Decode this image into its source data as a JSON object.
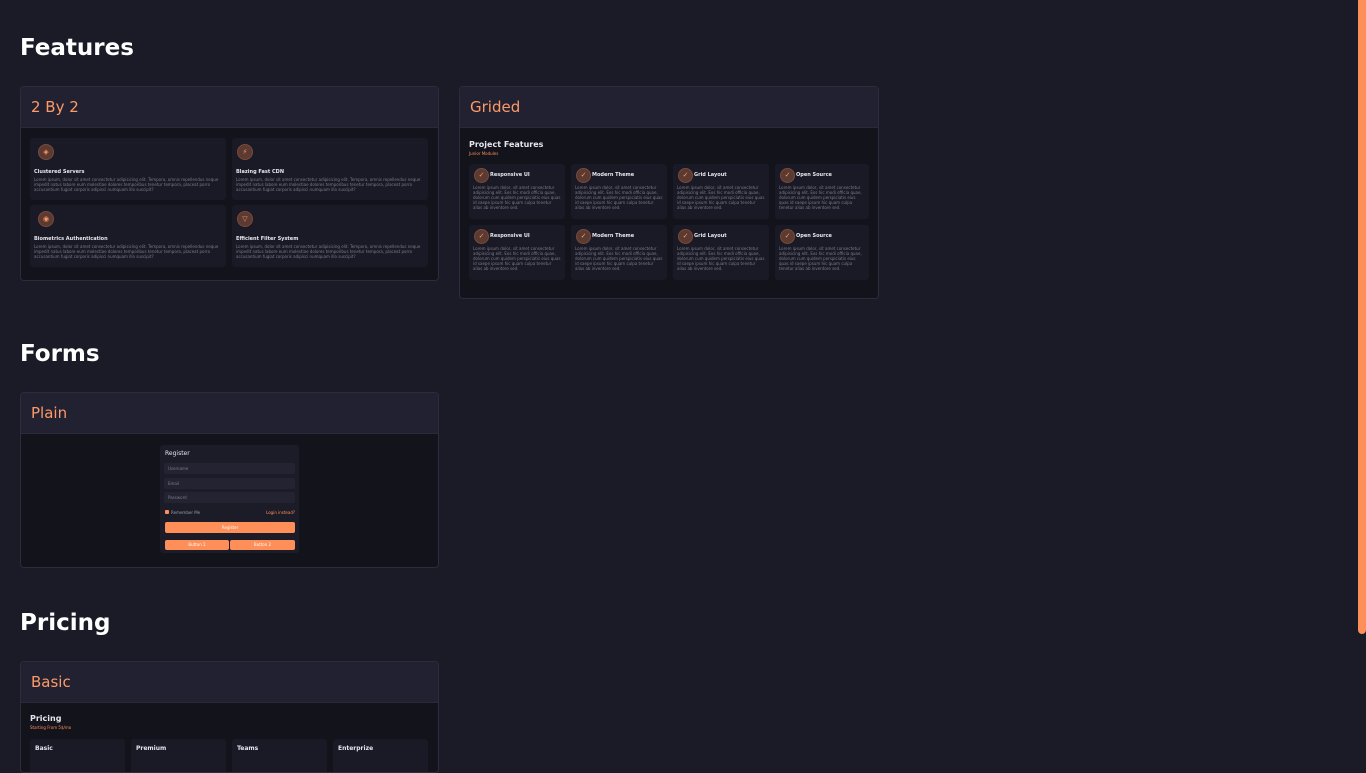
{
  "sections": {
    "features": "Features",
    "forms": "Forms",
    "pricing": "Pricing"
  },
  "cards": {
    "two_by_two": {
      "title": "2 By 2",
      "items": [
        {
          "title": "Clustered Servers",
          "icon": "server-icon",
          "text": "Lorem ipsum, dolor sit amet consectetur adipisicing elit. Tempora, omnis repellendus neque impedit natus labore eum molestiae dolores temporibus tenetur tempora, placeat porro accusantium fugiat corporis adipisci numquam illo suscipit?"
        },
        {
          "title": "Blazing Fast CDN",
          "icon": "bolt-icon",
          "text": "Lorem ipsum, dolor sit amet consectetur adipisicing elit. Tempora, omnis repellendus neque impedit natus labore eum molestiae dolores temporibus tenetur tempora, placeat porro accusantium fugiat corporis adipisci numquam illo suscipit?"
        },
        {
          "title": "Biometrics Authentication",
          "icon": "fingerprint-icon",
          "text": "Lorem ipsum, dolor sit amet consectetur adipisicing elit. Tempora, omnis repellendus neque impedit natus labore eum molestiae dolores temporibus tenetur tempora, placeat porro accusantium fugiat corporis adipisci numquam illo suscipit?"
        },
        {
          "title": "Efficient Filter System",
          "icon": "filter-icon",
          "text": "Lorem ipsum, dolor sit amet consectetur adipisicing elit. Tempora, omnis repellendus neque impedit natus labore eum molestiae dolores temporibus tenetur tempora, placeat porro accusantium fugiat corporis adipisci numquam illo suscipit?"
        }
      ]
    },
    "grided": {
      "title": "Grided",
      "heading": "Project Features",
      "subheading": "Junior Modules",
      "items": [
        {
          "title": "Responsive UI",
          "text": "Lorem ipsum dolor, sit amet consectetur adipisicing elit. Eos hic modi officia quae, dolorum cum quidem perspiciatis eius quas id saepe ipsum hic quam culpa tenetur alias ab inventore sed."
        },
        {
          "title": "Modern Theme",
          "text": "Lorem ipsum dolor, sit amet consectetur adipisicing elit. Eos hic modi officia quae, dolorum cum quidem perspiciatis eius quas id saepe ipsum hic quam culpa tenetur alias ab inventore sed."
        },
        {
          "title": "Grid Layout",
          "text": "Lorem ipsum dolor, sit amet consectetur adipisicing elit. Eos hic modi officia quae, dolorum cum quidem perspiciatis eius quas id saepe ipsum hic quam culpa tenetur alias ab inventore sed."
        },
        {
          "title": "Open Source",
          "text": "Lorem ipsum dolor, sit amet consectetur adipisicing elit. Eos hic modi officia quae, dolorum cum quidem perspiciatis eius quas id saepe ipsum hic quam culpa tenetur alias ab inventore sed."
        },
        {
          "title": "Responsive UI",
          "text": "Lorem ipsum dolor, sit amet consectetur adipisicing elit. Eos hic modi officia quae, dolorum cum quidem perspiciatis eius quas id saepe ipsum hic quam culpa tenetur alias ab inventore sed."
        },
        {
          "title": "Modern Theme",
          "text": "Lorem ipsum dolor, sit amet consectetur adipisicing elit. Eos hic modi officia quae, dolorum cum quidem perspiciatis eius quas id saepe ipsum hic quam culpa tenetur alias ab inventore sed."
        },
        {
          "title": "Grid Layout",
          "text": "Lorem ipsum dolor, sit amet consectetur adipisicing elit. Eos hic modi officia quae, dolorum cum quidem perspiciatis eius quas id saepe ipsum hic quam culpa tenetur alias ab inventore sed."
        },
        {
          "title": "Open Source",
          "text": "Lorem ipsum dolor, sit amet consectetur adipisicing elit. Eos hic modi officia quae, dolorum cum quidem perspiciatis eius quas id saepe ipsum hic quam culpa tenetur alias ab inventore sed."
        }
      ]
    },
    "plain": {
      "title": "Plain",
      "form_title": "Register",
      "username_placeholder": "Username",
      "email_placeholder": "Email",
      "password_placeholder": "Password",
      "remember_label": "Remember Me",
      "login_link": "Login instead?",
      "register_button": "Register",
      "button_1": "Button 1",
      "button_2": "Button 2"
    },
    "basic": {
      "title": "Basic",
      "heading": "Pricing",
      "subheading": "Starting From 5$/mo",
      "plans": [
        "Basic",
        "Premium",
        "Teams",
        "Enterprize"
      ]
    }
  },
  "colors": {
    "accent": "#ff8f59",
    "background": "#1b1b27",
    "card_header": "#212131"
  }
}
